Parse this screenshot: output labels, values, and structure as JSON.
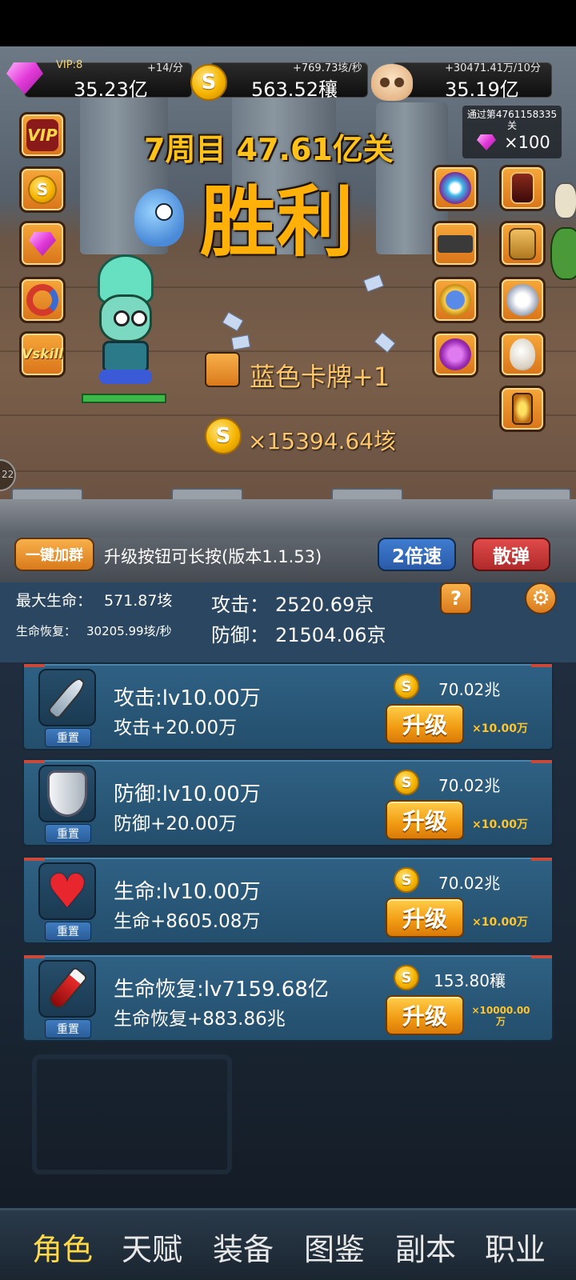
{
  "resources": {
    "vip": "VIP:8",
    "gem_rate": "+14/分",
    "gem_value": "35.23亿",
    "coin_rate": "+769.73垓/秒",
    "coin_value": "563.52穰",
    "skull_rate": "+30471.41万/10分",
    "skull_value": "35.19亿"
  },
  "stage": {
    "title": "7周目 47.61亿关",
    "result": "胜利",
    "pass_text": "通过第4761158335关",
    "pass_reward": "×100"
  },
  "left_buttons": [
    {
      "name": "vip-button",
      "label": "VIP"
    },
    {
      "name": "coin-shop-button",
      "label": "S"
    },
    {
      "name": "gem-shop-button",
      "label": ""
    },
    {
      "name": "magnet-button",
      "label": ""
    },
    {
      "name": "vskill-button",
      "label": "Vskill"
    }
  ],
  "drops": {
    "card_text": "蓝色卡牌+1",
    "coin_text": "×15394.64垓",
    "side_badge": "22"
  },
  "strip": {
    "join_group": "一键加群",
    "hint": "升级按钮可长按(版本1.1.53)",
    "speed": "2倍速",
    "scatter": "散弹"
  },
  "stats": {
    "max_hp_label": "最大生命：",
    "max_hp": "571.87垓",
    "regen_label": "生命恢复：",
    "regen": "30205.99垓/秒",
    "attack_label": "攻击：",
    "attack": "2520.69京",
    "defense_label": "防御：",
    "defense": "21504.06京",
    "help": "?"
  },
  "upgrades": [
    {
      "level": "攻击:lv10.00万",
      "effect": "攻击+20.00万",
      "cost": "70.02兆",
      "button": "升级",
      "multiplier": "×10.00万",
      "reset": "重置"
    },
    {
      "level": "防御:lv10.00万",
      "effect": "防御+20.00万",
      "cost": "70.02兆",
      "button": "升级",
      "multiplier": "×10.00万",
      "reset": "重置"
    },
    {
      "level": "生命:lv10.00万",
      "effect": "生命+8605.08万",
      "cost": "70.02兆",
      "button": "升级",
      "multiplier": "×10.00万",
      "reset": "重置"
    },
    {
      "level": "生命恢复:lv7159.68亿",
      "effect": "生命恢复+883.86兆",
      "cost": "153.80穰",
      "button": "升级",
      "multiplier": "×10000.00万",
      "reset": "重置"
    }
  ],
  "nav": [
    "角色",
    "天赋",
    "装备",
    "图鉴",
    "副本",
    "职业"
  ],
  "colors": {
    "accent": "#ffc21a",
    "panel": "#2a4660",
    "button": "#f19a12"
  }
}
